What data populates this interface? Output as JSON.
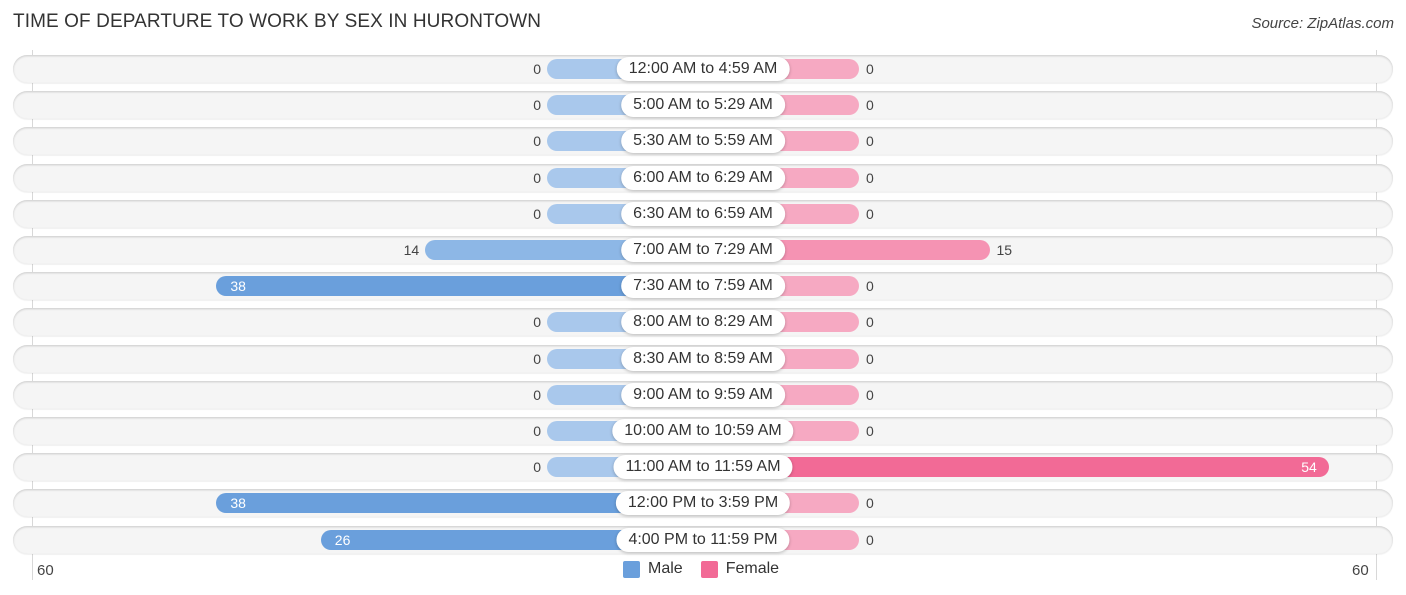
{
  "header": {
    "title": "TIME OF DEPARTURE TO WORK BY SEX IN HURONTOWN",
    "source": "Source: ZipAtlas.com"
  },
  "colors": {
    "male_light": "#a9c8ec",
    "male_strong": "#6a9fdc",
    "female_light": "#f6a9c2",
    "female_strong": "#f26a96"
  },
  "chart_data": {
    "type": "bar",
    "orientation": "horizontal-diverging",
    "title": "TIME OF DEPARTURE TO WORK BY SEX IN HURONTOWN",
    "categories": [
      "12:00 AM to 4:59 AM",
      "5:00 AM to 5:29 AM",
      "5:30 AM to 5:59 AM",
      "6:00 AM to 6:29 AM",
      "6:30 AM to 6:59 AM",
      "7:00 AM to 7:29 AM",
      "7:30 AM to 7:59 AM",
      "8:00 AM to 8:29 AM",
      "8:30 AM to 8:59 AM",
      "9:00 AM to 9:59 AM",
      "10:00 AM to 10:59 AM",
      "11:00 AM to 11:59 AM",
      "12:00 PM to 3:59 PM",
      "4:00 PM to 11:59 PM"
    ],
    "series": [
      {
        "name": "Male",
        "values": [
          0,
          0,
          0,
          0,
          0,
          14,
          38,
          0,
          0,
          0,
          0,
          0,
          38,
          26
        ]
      },
      {
        "name": "Female",
        "values": [
          0,
          0,
          0,
          0,
          0,
          15,
          0,
          0,
          0,
          0,
          0,
          54,
          0,
          0
        ]
      }
    ],
    "axis": {
      "left_max": 60,
      "right_max": 60,
      "tick_labels": [
        "60",
        "60"
      ]
    },
    "legend": {
      "position": "bottom-center",
      "entries": [
        "Male",
        "Female"
      ]
    },
    "grid": false
  }
}
